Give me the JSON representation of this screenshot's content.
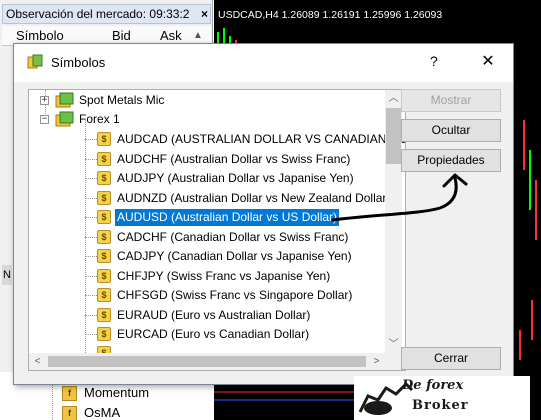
{
  "market_watch": {
    "title": "Observación del mercado: 09:33:2",
    "close": "×",
    "col_symbol": "Símbolo",
    "col_bid": "Bid",
    "col_ask": "Ask",
    "nav_items": [
      "Momentum",
      "OsMA"
    ]
  },
  "chart": {
    "title": "USDCAD,H4  1.26089 1.26191 1.25996 1.26093"
  },
  "dialog": {
    "title": "Símbolos",
    "help": "?",
    "close": "✕",
    "groups": [
      {
        "label": "Spot Metals Mic",
        "expander": "+"
      },
      {
        "label": "Forex 1",
        "expander": "−"
      }
    ],
    "symbols": [
      {
        "label": "AUDCAD  (AUSTRALIAN DOLLAR VS CANADIAN DC",
        "selected": false
      },
      {
        "label": "AUDCHF  (Australian Dollar vs Swiss Franc)",
        "selected": false
      },
      {
        "label": "AUDJPY  (Australian Dollar vs Japanise Yen)",
        "selected": false
      },
      {
        "label": "AUDNZD  (Australian Dollar vs New Zealand Dollar)",
        "selected": false
      },
      {
        "label": "AUDUSD  (Australian Dollar vs US Dollar)",
        "selected": true
      },
      {
        "label": "CADCHF  (Canadian Dollar vs Swiss Franc)",
        "selected": false
      },
      {
        "label": "CADJPY  (Canadian Dollar vs Japanise Yen)",
        "selected": false
      },
      {
        "label": "CHFJPY  (Swiss Franc vs Japanise Yen)",
        "selected": false
      },
      {
        "label": "CHFSGD  (Swiss Franc vs Singapore Dollar)",
        "selected": false
      },
      {
        "label": "EURAUD  (Euro vs Australian Dollar)",
        "selected": false
      },
      {
        "label": "EURCAD  (Euro vs Canadian Dollar)",
        "selected": false
      }
    ],
    "buttons": {
      "show": "Mostrar",
      "hide": "Ocultar",
      "properties": "Propiedades",
      "close": "Cerrar"
    }
  },
  "watermark": {
    "line1": "De forex",
    "line2": "Broker"
  },
  "colors": {
    "selection": "#0078d7",
    "chart_bg": "#000000",
    "bull": "#00ff00",
    "bear": "#ff3030"
  }
}
